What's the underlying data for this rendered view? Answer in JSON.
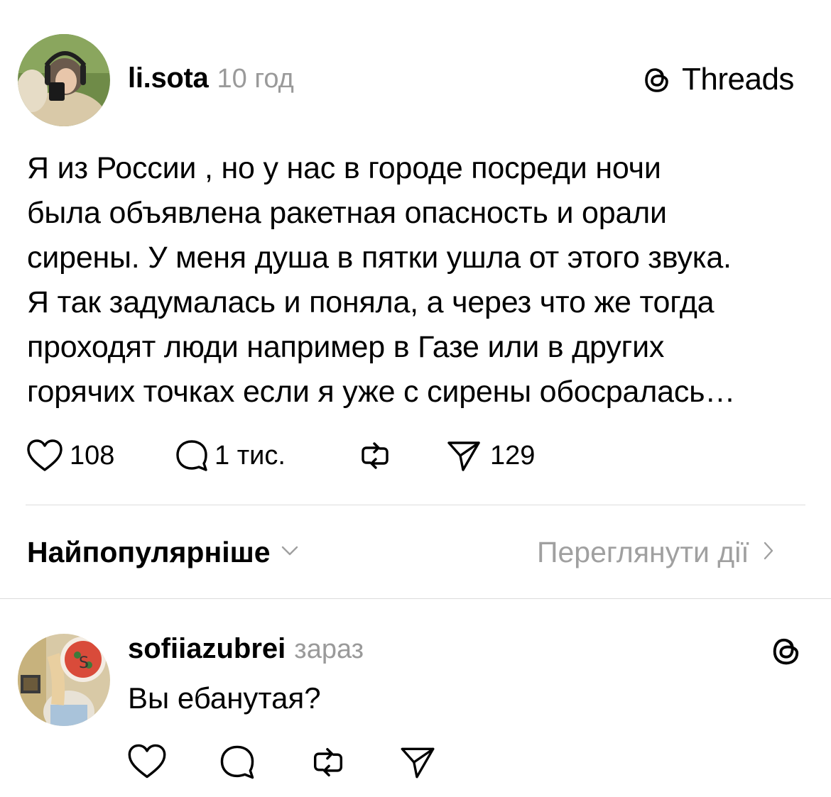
{
  "post": {
    "author": "li.sota",
    "time": "10 год",
    "brand": "Threads",
    "lines": [
      "Я из России , но у нас в городе посреди ночи",
      "была объявлена ракетная опасность и орали",
      "сирены. У меня душа в пятки ушла от этого звука.",
      "Я так задумалась и поняла, а через что же тогда",
      "проходят люди например в Газе или в других",
      "горячих точках если я уже с сирены обосралась…"
    ],
    "likes": "108",
    "replies": "1 тис.",
    "shares": "129"
  },
  "sort": {
    "label": "Найпопулярніше",
    "activity": "Переглянути дії"
  },
  "reply": {
    "author": "sofiiazubrei",
    "time": "зараз",
    "text": "Вы ебанутая?"
  }
}
